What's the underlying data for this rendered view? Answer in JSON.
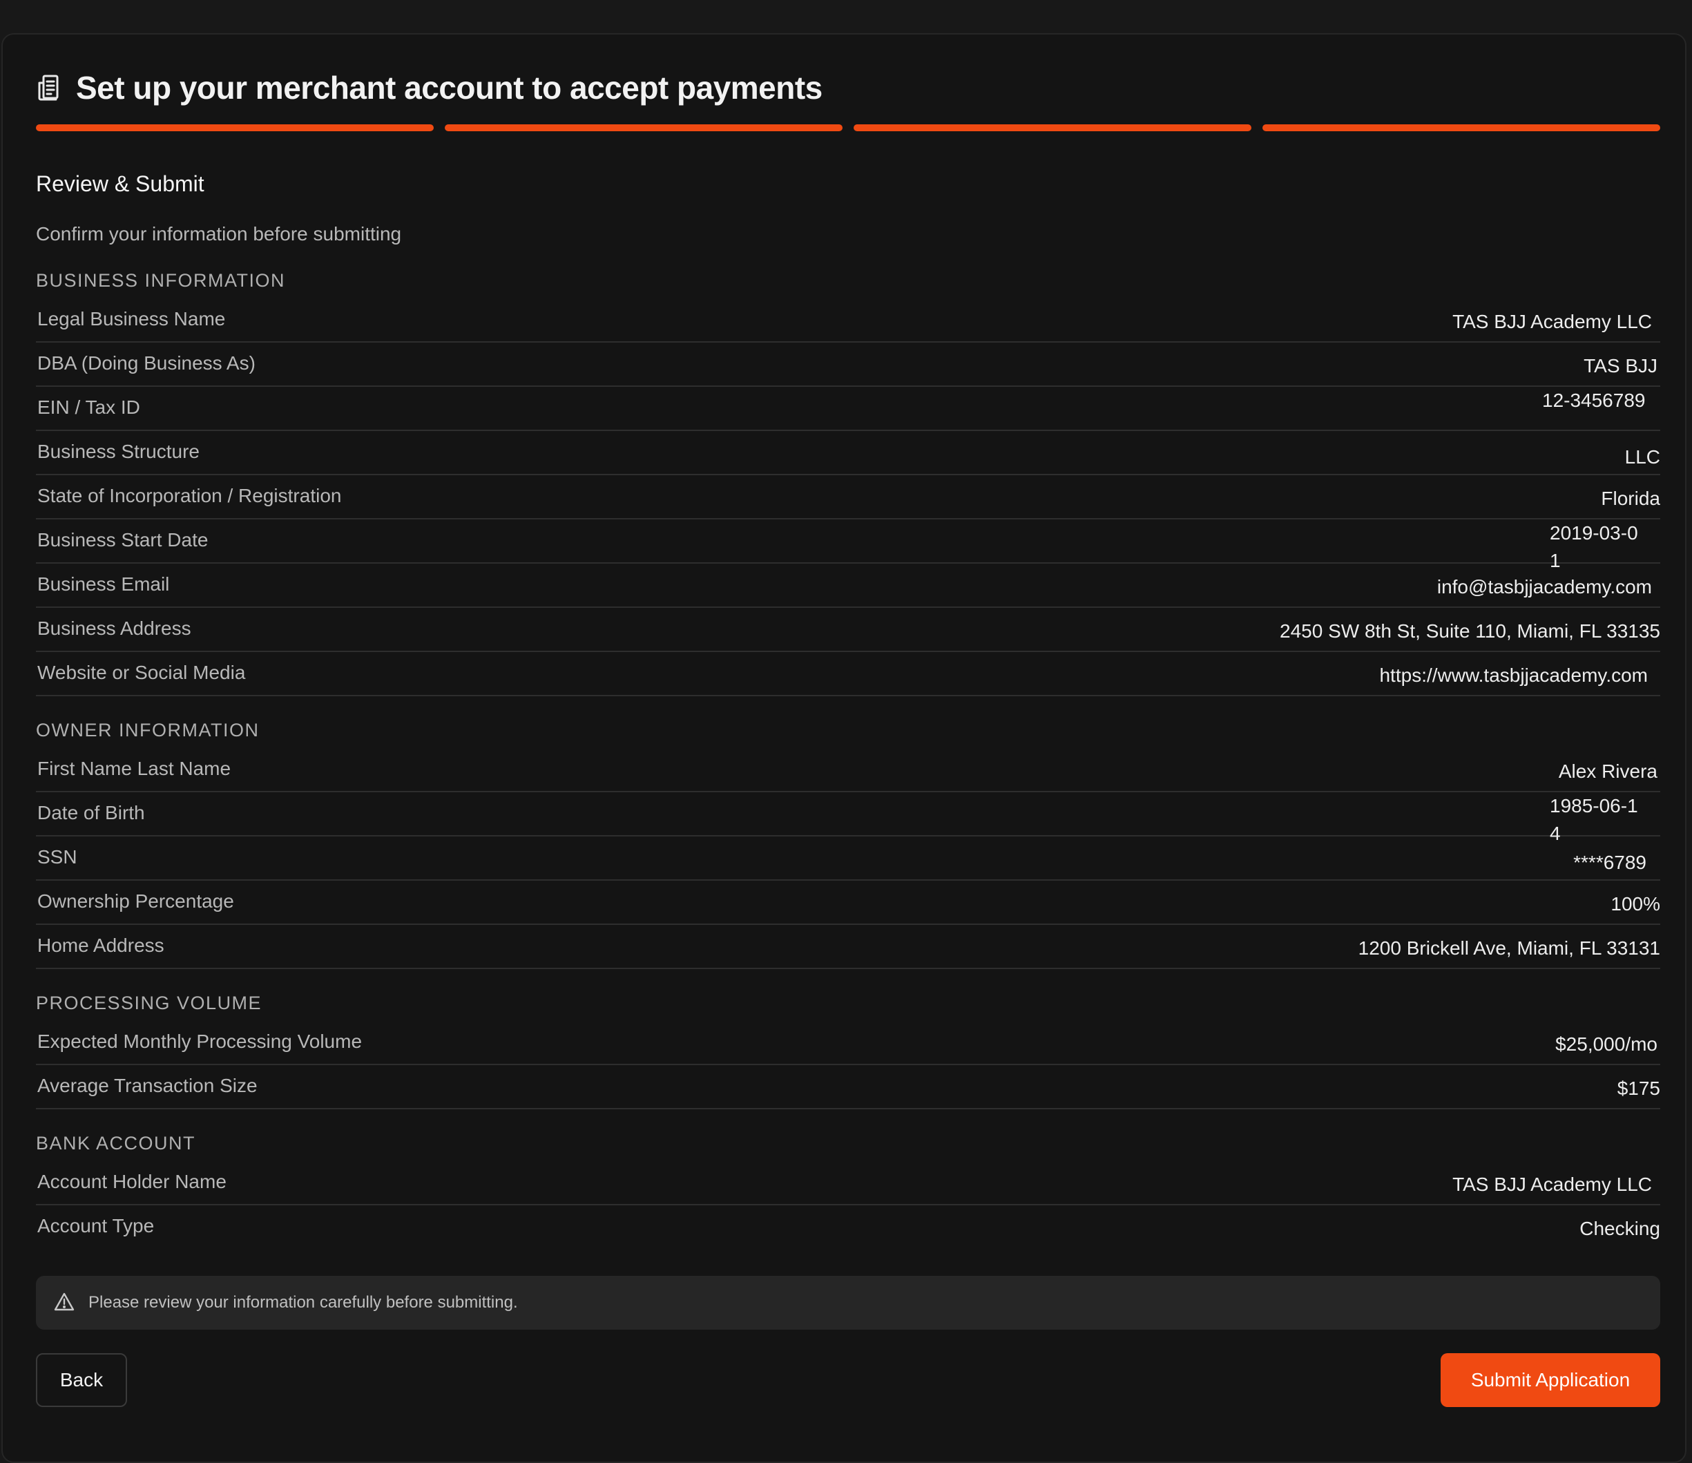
{
  "header": {
    "title": "Set up your merchant account to accept payments",
    "icon": "document-icon",
    "progress_steps": 4,
    "progress_completed": 4,
    "accent_color": "#f04a12"
  },
  "step": {
    "title": "Review & Submit",
    "subtitle": "Confirm your information before submitting"
  },
  "business": {
    "heading": "BUSINESS INFORMATION",
    "rows": [
      {
        "label": "Legal Business Name",
        "value": "TAS BJJ Academy LLC"
      },
      {
        "label": "DBA (Doing Business As)",
        "value": "TAS BJJ"
      },
      {
        "label": "EIN / Tax ID",
        "value": "12-3456789"
      },
      {
        "label": "Business Structure",
        "value": "LLC"
      },
      {
        "label": "State of Incorporation / Registration",
        "value": "Florida"
      },
      {
        "label": "Business Start Date",
        "value": "2019-03-01"
      },
      {
        "label": "Business Email",
        "value": "info@tasbjjacademy.com"
      },
      {
        "label": "Business Address",
        "value": "2450 SW 8th St, Suite 110, Miami, FL 33135"
      },
      {
        "label": "Website or Social Media",
        "value": "https://www.tasbjjacademy.com"
      }
    ]
  },
  "owner": {
    "heading": "OWNER INFORMATION",
    "rows": [
      {
        "label": "First Name Last Name",
        "value": "Alex Rivera"
      },
      {
        "label": "Date of Birth",
        "value": "1985-06-14"
      },
      {
        "label": "SSN",
        "value": "****6789"
      },
      {
        "label": "Ownership Percentage",
        "value": "100%"
      },
      {
        "label": "Home Address",
        "value": "1200 Brickell Ave, Miami, FL 33131"
      }
    ]
  },
  "volume": {
    "heading": "PROCESSING VOLUME",
    "rows": [
      {
        "label": "Expected Monthly Processing Volume",
        "value": "$25,000/mo"
      },
      {
        "label": "Average Transaction Size",
        "value": "$175"
      }
    ]
  },
  "bank": {
    "heading": "BANK ACCOUNT",
    "rows": [
      {
        "label": "Account Holder Name",
        "value": "TAS BJJ Academy LLC"
      },
      {
        "label": "Account Type",
        "value": "Checking"
      }
    ]
  },
  "notice": {
    "icon": "warning-icon",
    "text": "Please review your information carefully before submitting."
  },
  "actions": {
    "back_label": "Back",
    "submit_label": "Submit Application"
  }
}
